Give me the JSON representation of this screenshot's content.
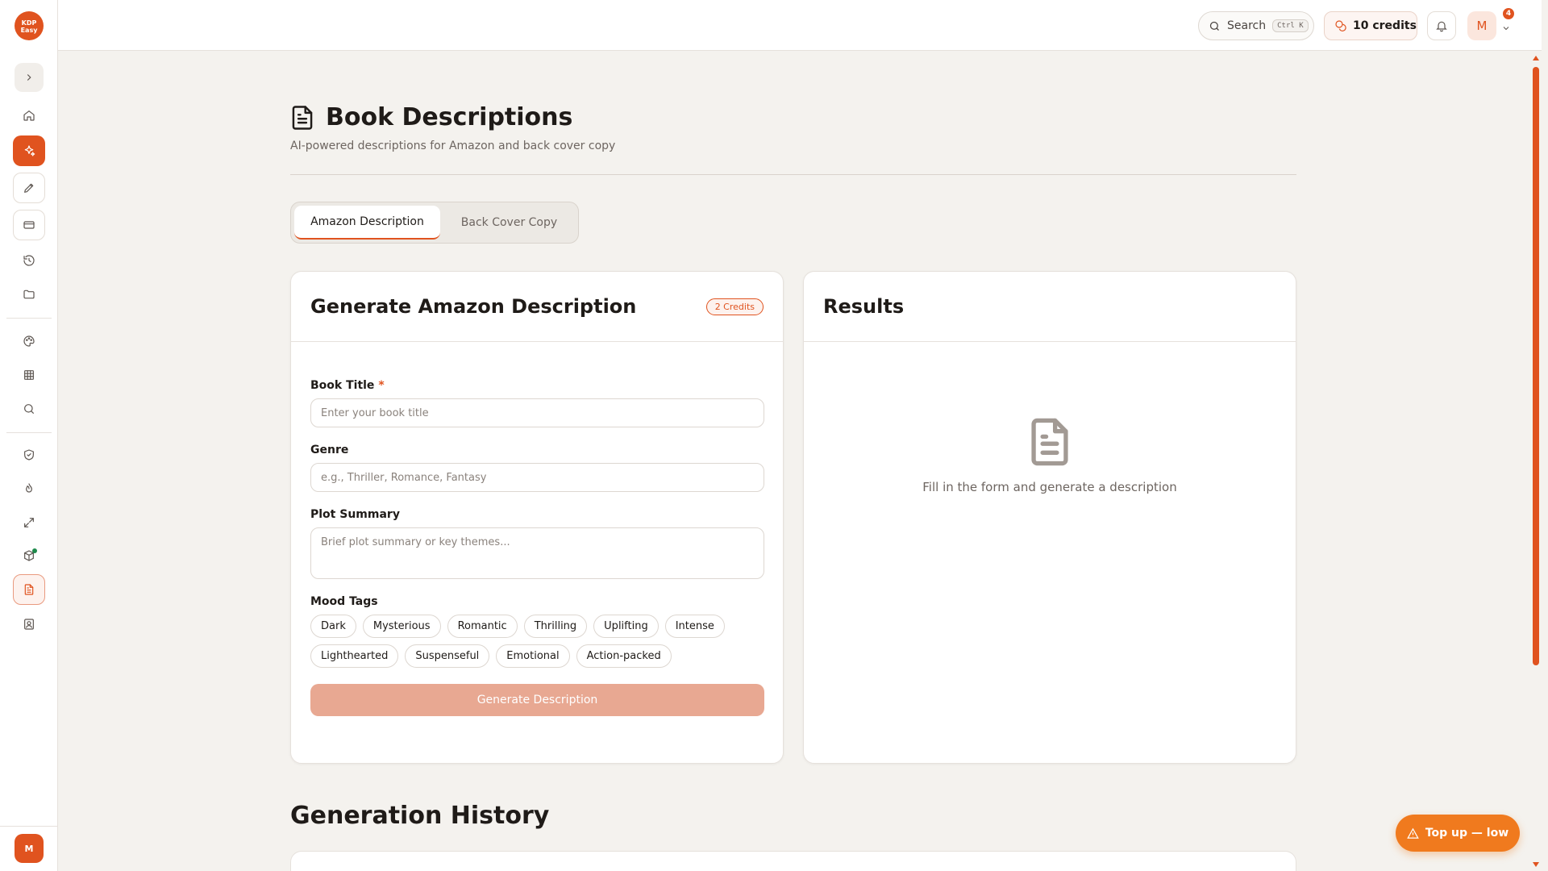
{
  "app": {
    "logo_text_line1": "KDP",
    "logo_text_line2": "Easy"
  },
  "topbar": {
    "search_label": "Search",
    "search_shortcut": "Ctrl K",
    "credits_label": "10 credits",
    "notification_count": "4",
    "user_initial": "M"
  },
  "sidebar": {
    "user_initial": "M",
    "items": [
      {
        "icon": "home-icon"
      },
      {
        "icon": "sparkles-icon",
        "active": true
      },
      {
        "icon": "pen-icon"
      },
      {
        "icon": "card-icon"
      },
      {
        "icon": "history-icon"
      },
      {
        "icon": "folder-icon"
      },
      {
        "icon": "palette-icon"
      },
      {
        "icon": "grid-icon"
      },
      {
        "icon": "search-icon"
      },
      {
        "icon": "shield-icon"
      },
      {
        "icon": "flame-icon"
      },
      {
        "icon": "expand-icon"
      },
      {
        "icon": "box-icon"
      },
      {
        "icon": "document-icon",
        "current": true
      },
      {
        "icon": "contact-icon"
      }
    ]
  },
  "page": {
    "title": "Book Descriptions",
    "subtitle": "AI-powered descriptions for Amazon and back cover copy"
  },
  "tabs": [
    {
      "label": "Amazon Description",
      "active": true
    },
    {
      "label": "Back Cover Copy",
      "active": false
    }
  ],
  "form": {
    "title": "Generate Amazon Description",
    "credits_badge": "2 Credits",
    "book_title_label": "Book Title",
    "required_mark": "*",
    "book_title_placeholder": "Enter your book title",
    "genre_label": "Genre",
    "genre_placeholder": "e.g., Thriller, Romance, Fantasy",
    "plot_label": "Plot Summary",
    "plot_placeholder": "Brief plot summary or key themes...",
    "mood_label": "Mood Tags",
    "mood_tags": [
      "Dark",
      "Mysterious",
      "Romantic",
      "Thrilling",
      "Uplifting",
      "Intense",
      "Lighthearted",
      "Suspenseful",
      "Emotional",
      "Action-packed"
    ],
    "generate_label": "Generate Description"
  },
  "results": {
    "title": "Results",
    "empty_text": "Fill in the form and generate a description"
  },
  "history": {
    "title": "Generation History"
  },
  "topup": {
    "label": "Top up — low"
  },
  "colors": {
    "accent": "#e0531f",
    "accent_light": "#e8a892",
    "topup": "#f07a1e",
    "background": "#f4f2ee"
  }
}
